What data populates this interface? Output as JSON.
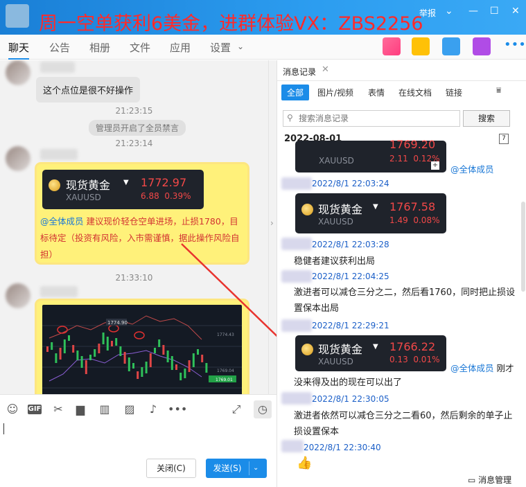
{
  "window": {
    "promo_text": "周一空单获利6美金，进群体验VX：ZBS2256",
    "report_label": "举报",
    "min_icon": "minimize-icon",
    "max_icon": "maximize-icon",
    "close_icon": "close-icon"
  },
  "tabs": [
    "聊天",
    "公告",
    "相册",
    "文件",
    "应用",
    "设置"
  ],
  "chat": {
    "msg1_text": "这个点位是很不好操作",
    "time1": "21:23:15",
    "system_msg": "管理员开启了全员禁言",
    "time2": "21:23:14",
    "card1": {
      "name": "现货黄金",
      "symbol": "XAUUSD",
      "price": "1772.97",
      "change": "6.88",
      "percent": "0.39%"
    },
    "at_all": "@全体成员",
    "msg2_text": "建议现价轻仓空单进场，止损1780，目标待定（投资有风险，入市需谨慎，据此操作风险自担）",
    "time3": "21:33:10",
    "chart_labels": {
      "high": "1774.90",
      "p1": "1774.43",
      "p2": "1769.04",
      "last": "1769.01"
    }
  },
  "toolbar": {
    "icons": [
      "emoji-icon",
      "gif-icon",
      "scissors-icon",
      "folder-icon",
      "book-icon",
      "image-icon",
      "bell-icon",
      "more-icon"
    ],
    "close_label": "关闭(C)",
    "send_label": "发送(S)"
  },
  "history": {
    "tab_title": "消息记录",
    "filters": [
      "全部",
      "图片/视频",
      "表情",
      "在线文档",
      "链接"
    ],
    "search_placeholder": "搜索消息记录",
    "search_button": "搜索",
    "date_header": "2022-08-01",
    "card_top": {
      "price": "1769.20",
      "change": "2.11",
      "percent": "0.12%"
    },
    "at_all": "@全体成员",
    "entries": [
      {
        "time": "2022/8/1 22:03:24"
      },
      {
        "time": "2022/8/1 22:03:28",
        "text": "稳健者建议获利出局"
      },
      {
        "time": "2022/8/1 22:04:25",
        "text": "激进者可以减仓三分之二，然后看1760，同时把止损设置保本出局"
      },
      {
        "time": "2022/8/1 22:29:21"
      },
      {
        "time": "2022/8/1 22:30:05",
        "text": "激进者依然可以减仓三分之二看60，然后剩余的单子止损设置保本"
      },
      {
        "time": "2022/8/1 22:30:40"
      }
    ],
    "card2": {
      "name": "现货黄金",
      "symbol": "XAUUSD",
      "price": "1767.58",
      "change": "1.49",
      "percent": "0.08%"
    },
    "card3": {
      "name": "现货黄金",
      "symbol": "XAUUSD",
      "price": "1766.22",
      "change": "0.13",
      "percent": "0.01%"
    },
    "card3_suffix": "刚才",
    "card3_line2": "没来得及出的现在可以出了",
    "thumb": "👍",
    "manage_label": "消息管理"
  },
  "colors": {
    "accent": "#1b8ce8",
    "card_bg": "#1f232b",
    "price_red": "#f24848",
    "promo_red": "#ff2a2a",
    "highlight": "#fff17a"
  }
}
